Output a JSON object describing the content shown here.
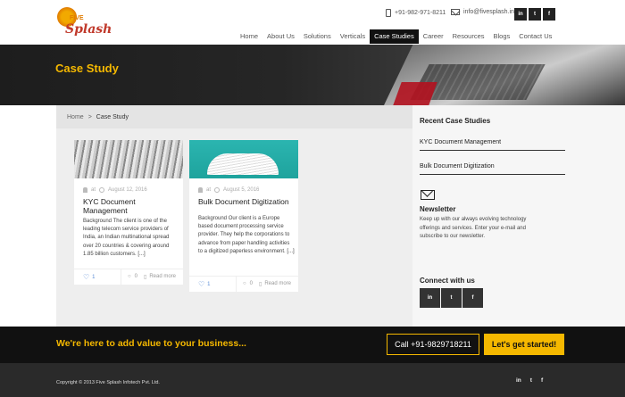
{
  "header": {
    "logo": {
      "five": "FIVE",
      "splash": "Splash"
    },
    "phone": "+91-982-971-8211",
    "email": "info@fivesplash.in",
    "social": [
      "in",
      "t",
      "f"
    ],
    "nav": [
      {
        "label": "Home"
      },
      {
        "label": "About Us"
      },
      {
        "label": "Solutions"
      },
      {
        "label": "Verticals"
      },
      {
        "label": "Case Studies",
        "active": true
      },
      {
        "label": "Career"
      },
      {
        "label": "Resources"
      },
      {
        "label": "Blogs"
      },
      {
        "label": "Contact Us"
      }
    ]
  },
  "banner": {
    "title": "Case Study"
  },
  "breadcrumb": {
    "home": "Home",
    "separator": ">",
    "current": "Case Study"
  },
  "cards": [
    {
      "author": "at",
      "date": "August 12, 2016",
      "title": "KYC Document Management",
      "excerpt": "Background The client is one of the leading telecom service providers of India, an Indian multinational spread over 20 countries & covering around 1.85 billion customers. [...]",
      "likes": "1",
      "comments": "0",
      "read_more": "Read more"
    },
    {
      "author": "at",
      "date": "August 5, 2016",
      "title": "Bulk Document Digitization",
      "excerpt": "Background Our client is a Europe based document processing service provider. They help the corporations to advance from paper handling activities to a digitized paperless environment. [...]",
      "likes": "1",
      "comments": "0",
      "read_more": "Read more"
    }
  ],
  "sidebar": {
    "recent_heading": "Recent Case Studies",
    "recent": [
      "KYC Document Management",
      "Bulk Document Digitization"
    ],
    "newsletter_heading": "Newsletter",
    "newsletter_text": "Keep up with our always evolving technology offerings and services. Enter your e-mail and subscribe to our newsletter.",
    "connect_heading": "Connect with us",
    "social": [
      "in",
      "t",
      "f"
    ]
  },
  "cta": {
    "message": "We're here to add value to your business...",
    "call": "Call +91-9829718211",
    "start": "Let's get started!"
  },
  "footer": {
    "copyright": "Copyright © 2013 Five Splash Infotech Pvt. Ltd.",
    "social": [
      "in",
      "t",
      "f"
    ]
  },
  "colors": {
    "accent": "#f5b800",
    "dark": "#111111",
    "link_blue": "#5b8dd6"
  }
}
